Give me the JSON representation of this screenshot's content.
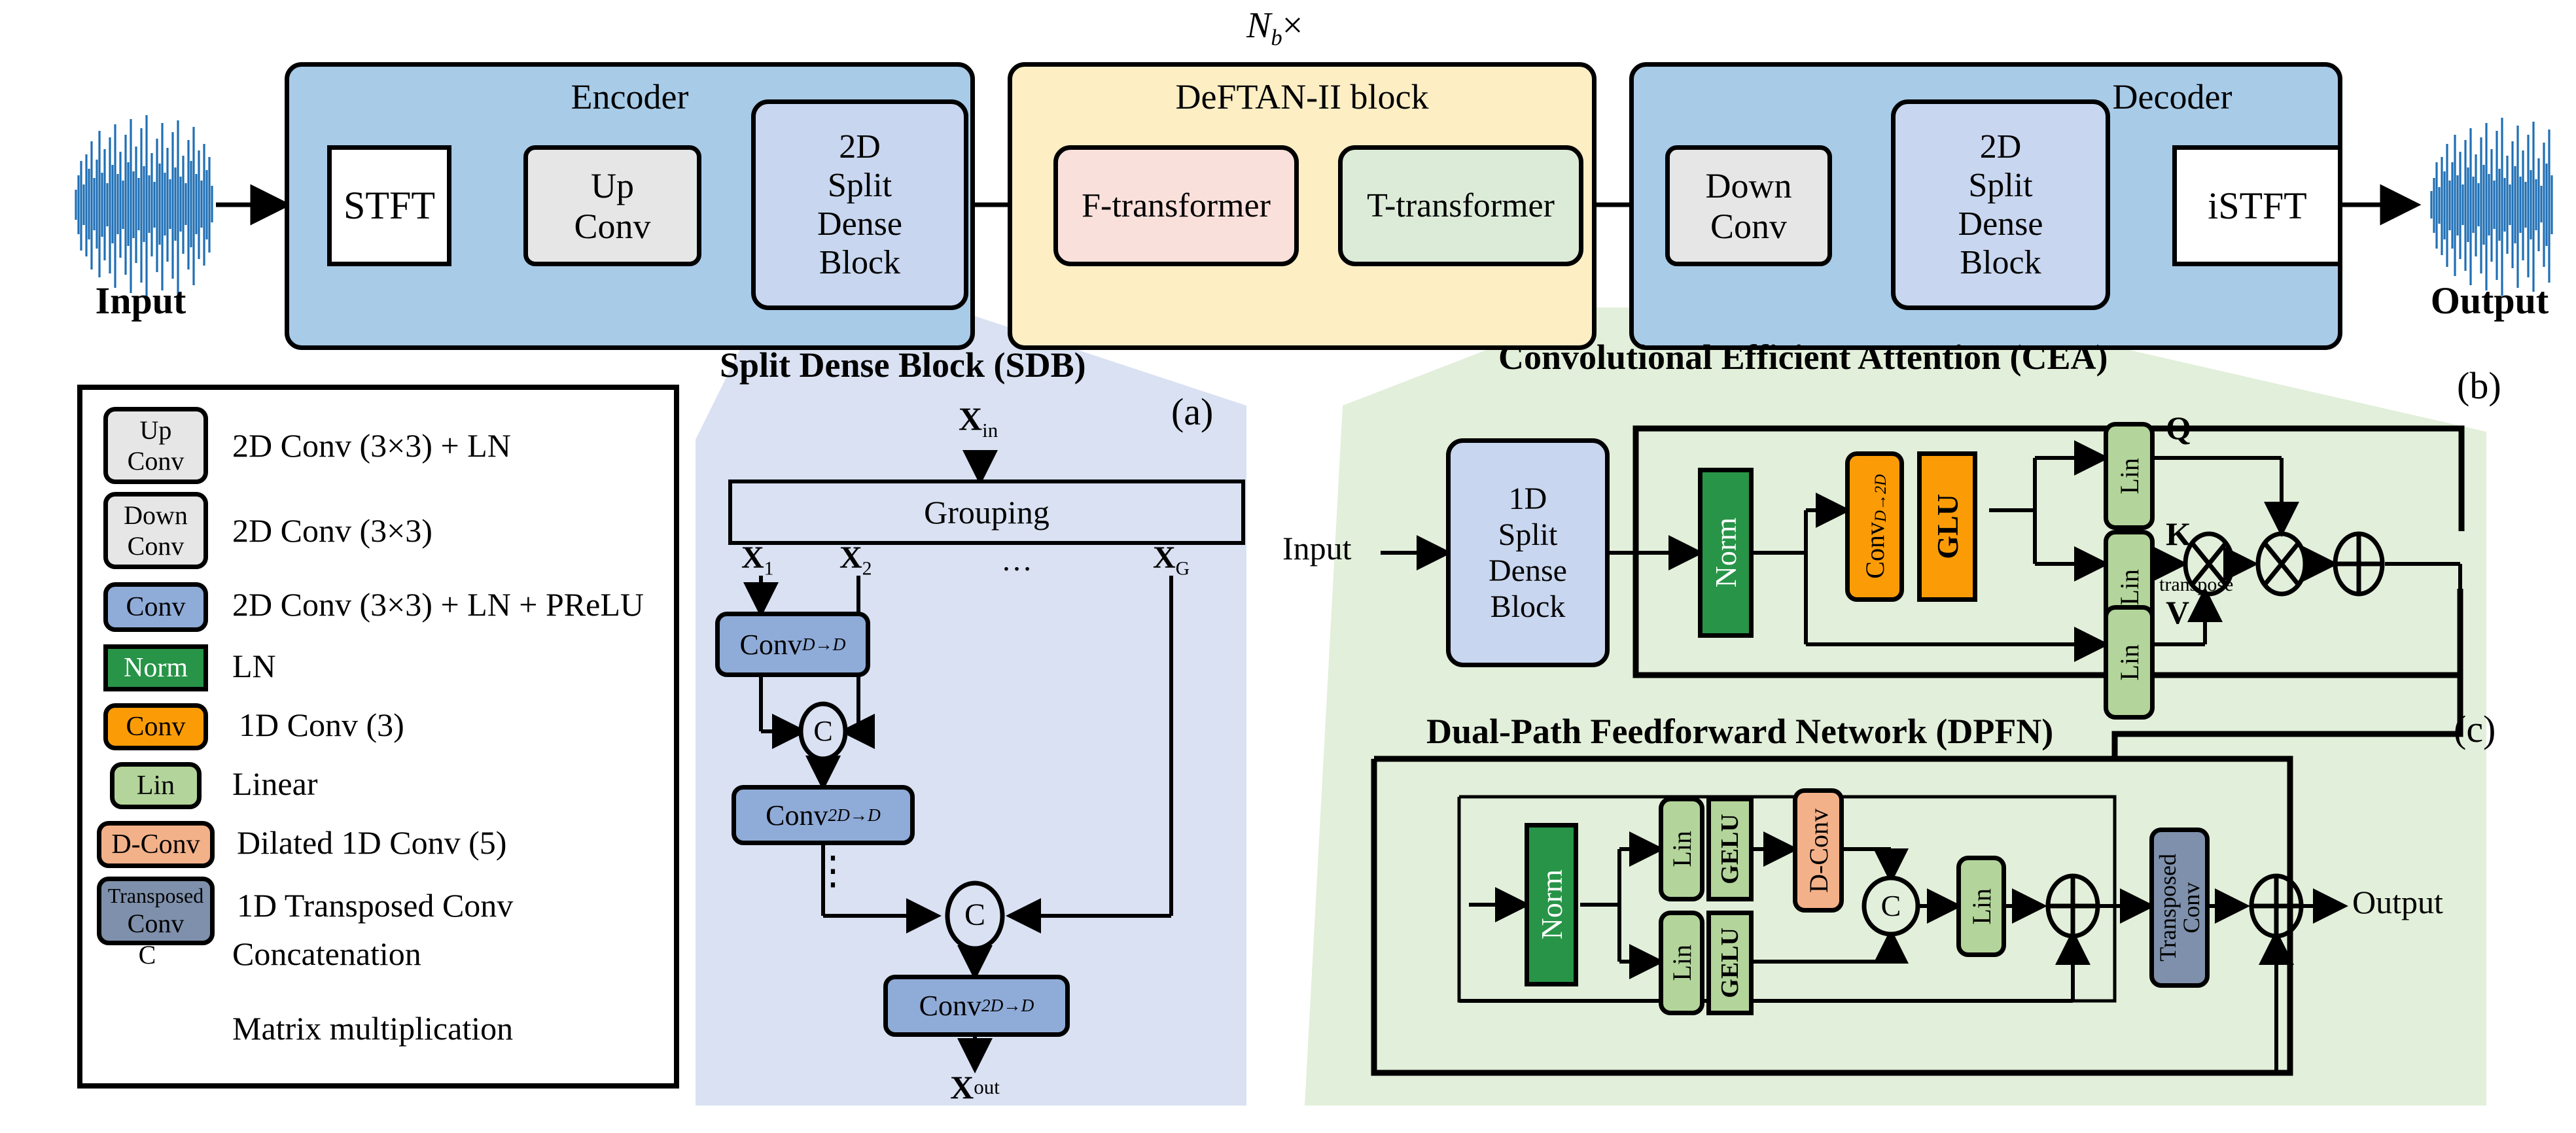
{
  "colors": {
    "encoder_blue": "#a8cbe8",
    "deftan_yellow": "#fdeec4",
    "sdb_light_blue": "#c8d6ef",
    "f_transformer_pink": "#fae0db",
    "t_transformer_green": "#dcebd8",
    "grey_block": "#e6e6e6",
    "conv_blue": "#8fabd8",
    "norm_green": "#279447",
    "conv_orange": "#fb9c06",
    "lin_green": "#b3d49a",
    "dconv_peach": "#f3b189",
    "transposed_slate": "#7e90ab",
    "panel_a_fill": "#d9e1f2",
    "panel_bc_fill": "#e2efda",
    "waveform_blue": "#1f6fb5",
    "stroke": "#000000"
  },
  "top_pipeline": {
    "input_label": "Input",
    "output_label": "Output",
    "repeat_label": "N",
    "repeat_sub": "b",
    "repeat_times": "×",
    "encoder": {
      "title": "Encoder",
      "blocks": [
        {
          "label": "STFT"
        },
        {
          "label_line1": "Up",
          "label_line2": "Conv"
        },
        {
          "label_line1": "2D",
          "label_line2": "Split",
          "label_line3": "Dense",
          "label_line4": "Block"
        }
      ]
    },
    "deftan": {
      "title": "DeFTAN-II block",
      "blocks": [
        {
          "label": "F-transformer"
        },
        {
          "label": "T-transformer"
        }
      ]
    },
    "decoder": {
      "title": "Decoder",
      "blocks": [
        {
          "label_line1": "Down",
          "label_line2": "Conv"
        },
        {
          "label_line1": "2D",
          "label_line2": "Split",
          "label_line3": "Dense",
          "label_line4": "Block"
        },
        {
          "label": "iSTFT"
        }
      ]
    }
  },
  "legend": {
    "items": [
      {
        "icon_line1": "Up",
        "icon_line2": "Conv",
        "text": "2D Conv (3×3) + LN",
        "icon_style": "grey-round"
      },
      {
        "icon_line1": "Down",
        "icon_line2": "Conv",
        "text": "2D Conv (3×3)",
        "icon_style": "grey-round"
      },
      {
        "icon_line1": "Conv",
        "icon_line2": "",
        "text": "2D Conv (3×3) + LN + PReLU",
        "icon_style": "blue-round"
      },
      {
        "icon_line1": "Norm",
        "icon_line2": "",
        "text": "LN",
        "icon_style": "green-square"
      },
      {
        "icon_line1": "Conv",
        "icon_line2": "",
        "text": "1D Conv (3)",
        "icon_style": "orange-round"
      },
      {
        "icon_line1": "Lin",
        "icon_line2": "",
        "text": "Linear",
        "icon_style": "lin-round"
      },
      {
        "icon_line1": "D-Conv",
        "icon_line2": "",
        "text": "Dilated 1D Conv (5)",
        "icon_style": "peach-round"
      },
      {
        "icon_line1": "Transposed",
        "icon_line2": "Conv",
        "text": "1D Transposed Conv",
        "icon_style": "slate-round"
      },
      {
        "icon_line1": "C",
        "icon_line2": "",
        "text": "Concatenation",
        "icon_style": "circle-c"
      },
      {
        "icon_line1": "⊗",
        "icon_line2": "",
        "text": "Matrix multiplication",
        "icon_style": "circle-x"
      }
    ]
  },
  "panel_a": {
    "tag": "(a)",
    "title": "Split Dense Block (SDB)",
    "input_label": "X",
    "input_sub": "in",
    "grouping_label": "Grouping",
    "branch_labels": [
      {
        "main": "X",
        "sub": "1"
      },
      {
        "main": "X",
        "sub": "2"
      },
      {
        "main": "…",
        "sub": ""
      },
      {
        "main": "X",
        "sub": "G"
      }
    ],
    "conv1_label": "Conv",
    "conv1_sub": "D→D",
    "conv2_label": "Conv",
    "conv2_sub": "2D→D",
    "conv3_label": "Conv",
    "conv3_sub": "2D→D",
    "concat_label": "C",
    "vdots": "⋮",
    "output_label": "X",
    "output_sub": "out"
  },
  "panel_b": {
    "tag": "(b)",
    "title": "Convolutional Efficient Attention (CEA)",
    "input_label": "Input",
    "sdb_block": {
      "l1": "1D",
      "l2": "Split",
      "l3": "Dense",
      "l4": "Block"
    },
    "norm_label": "Norm",
    "conv_label": "Conv",
    "conv_sub": "D→2D",
    "glu_label": "GLU",
    "lin_label": "Lin",
    "q_label": "Q",
    "k_label": "K",
    "v_label": "V",
    "transpose_label": "transpose",
    "matmul_symbol": "⊗",
    "add_symbol": "⊕"
  },
  "panel_c": {
    "tag": "(c)",
    "title": "Dual-Path Feedforward Network (DPFN)",
    "norm_label": "Norm",
    "lin_label": "Lin",
    "gelu_label": "GELU",
    "dconv_label": "D-Conv",
    "concat_label": "C",
    "transposed_label_l1": "Transposed",
    "transposed_label_l2": "Conv",
    "add_symbol": "⊕",
    "output_label": "Output"
  }
}
